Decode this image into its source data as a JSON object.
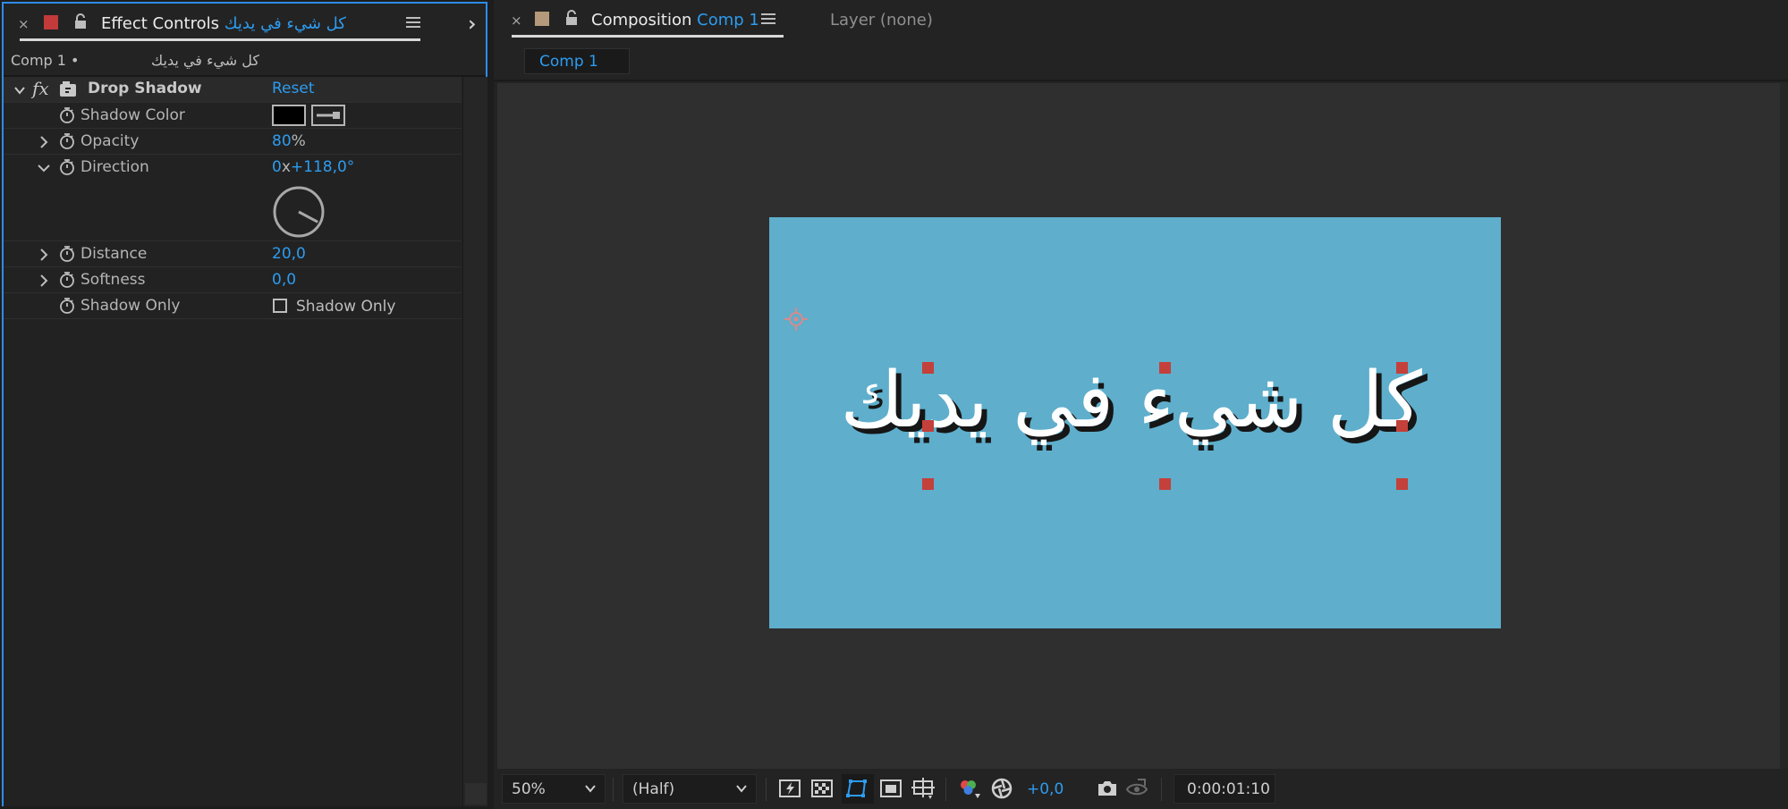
{
  "effect_controls": {
    "close": "×",
    "title": "Effect Controls",
    "layer_name": "كل شيء في يديك",
    "breadcrumb_comp": "Comp 1 •",
    "breadcrumb_layer": "كل شيء في يديك",
    "effect": {
      "fx": "fx",
      "name": "Drop Shadow",
      "reset": "Reset"
    },
    "properties": {
      "shadow_color": {
        "label": "Shadow Color",
        "swatch_color": "#000000"
      },
      "opacity": {
        "label": "Opacity",
        "value": "80",
        "unit": "%"
      },
      "direction": {
        "label": "Direction",
        "revolutions": "0",
        "sep": "x",
        "degrees": "+118,0°",
        "angle": 118
      },
      "distance": {
        "label": "Distance",
        "value": "20,0"
      },
      "softness": {
        "label": "Softness",
        "value": "0,0"
      },
      "shadow_only": {
        "label": "Shadow Only",
        "checkbox_label": "Shadow Only",
        "checked": false
      }
    }
  },
  "composition": {
    "close": "×",
    "title": "Composition",
    "comp_name": "Comp 1",
    "layer_tab": "Layer",
    "layer_value": "(none)",
    "viewer_tab": "Comp 1",
    "canvas_color": "#5eaecc",
    "canvas_text": "كل شيء في يديك",
    "toolbar": {
      "zoom": "50%",
      "resolution": "(Half)",
      "exposure": "+0,0",
      "timecode": "0:00:01:10"
    }
  },
  "colors": {
    "accent": "#2d9cf0",
    "panel_focus_border": "#2d8ceb",
    "handle": "#c4403a",
    "label_swatch_red": "#c23a3a",
    "label_swatch_tan": "#b49a7a"
  }
}
